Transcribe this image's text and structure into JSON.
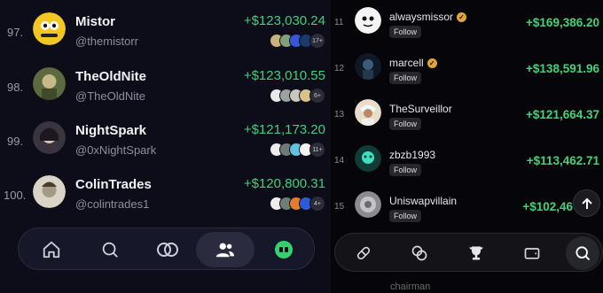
{
  "left": {
    "rows": [
      {
        "rank": "97.",
        "name": "Mistor",
        "handle": "@themistorr",
        "pnl": "+$123,030.24",
        "more": "17+"
      },
      {
        "rank": "98.",
        "name": "TheOldNite",
        "handle": "@TheOldNite",
        "pnl": "+$123,010.55",
        "more": "6+"
      },
      {
        "rank": "99.",
        "name": "NightSpark",
        "handle": "@0xNightSpark",
        "pnl": "+$121,173.20",
        "more": "11+"
      },
      {
        "rank": "100.",
        "name": "ColinTrades",
        "handle": "@colintrades1",
        "pnl": "+$120,800.31",
        "more": "4+"
      }
    ],
    "nav": [
      "home-icon",
      "search-icon",
      "trade-swap-icon",
      "users-icon",
      "app-logo-icon"
    ],
    "active_nav": "users-icon"
  },
  "right": {
    "rows": [
      {
        "rank": "11",
        "name": "alwaysmissor",
        "verified": true,
        "follow": "Follow",
        "pnl": "+$169,386.20"
      },
      {
        "rank": "12",
        "name": "marcell",
        "verified": true,
        "follow": "Follow",
        "pnl": "+$138,591.96"
      },
      {
        "rank": "13",
        "name": "TheSurveillor",
        "verified": false,
        "follow": "Follow",
        "pnl": "+$121,664.37"
      },
      {
        "rank": "14",
        "name": "zbzb1993",
        "verified": false,
        "follow": "Follow",
        "pnl": "+$113,462.71"
      },
      {
        "rank": "15",
        "name": "Uniswapvillain",
        "verified": false,
        "follow": "Follow",
        "pnl": "+$102,46"
      }
    ],
    "peek_name": "chairman",
    "nav": [
      "pill-icon",
      "coins-icon",
      "trophy-icon",
      "wallet-icon",
      "search-icon"
    ],
    "active_nav": "search-icon"
  },
  "colors": {
    "positive": "#3fd07a",
    "verified": "#e3a43a"
  }
}
